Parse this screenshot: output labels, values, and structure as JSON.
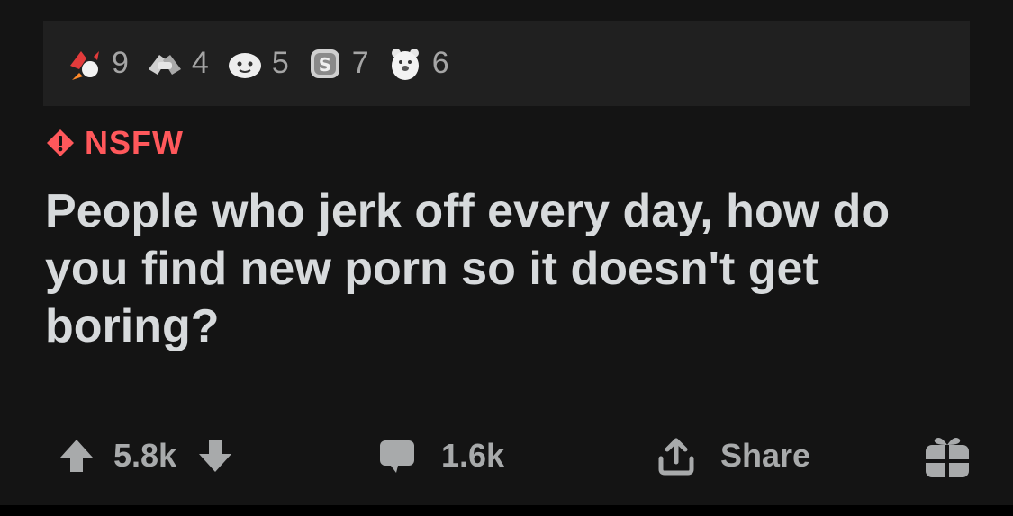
{
  "awards": [
    {
      "icon": "rocket-like-award-icon",
      "count": "9"
    },
    {
      "icon": "handshake-award-icon",
      "count": "4"
    },
    {
      "icon": "wholesome-face-award-icon",
      "count": "5"
    },
    {
      "icon": "silver-coin-award-icon",
      "count": "7"
    },
    {
      "icon": "polar-bear-award-icon",
      "count": "6"
    }
  ],
  "post": {
    "nsfw_label": "NSFW",
    "title": "People who jerk off every day, how do you find new porn so it doesn't get boring?"
  },
  "actions": {
    "upvotes": "5.8k",
    "comments": "1.6k",
    "share_label": "Share"
  },
  "colors": {
    "background": "#141414",
    "awards_bar": "#202020",
    "nsfw_red": "#ff585b",
    "title_text": "#d7dadc",
    "muted": "#a8aaab"
  }
}
